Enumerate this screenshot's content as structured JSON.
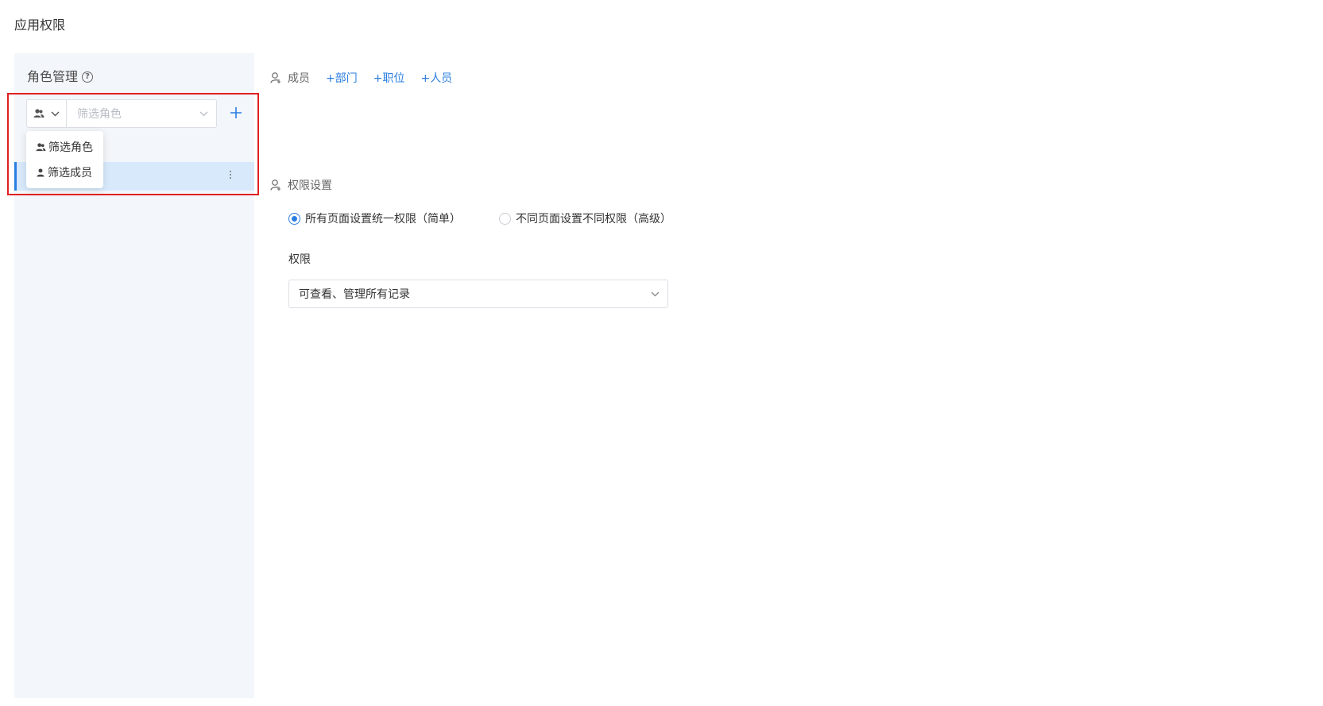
{
  "page": {
    "title": "应用权限"
  },
  "left_panel": {
    "heading": "角色管理",
    "filter": {
      "placeholder": "筛选角色"
    },
    "dropdown": {
      "items": [
        {
          "label": "筛选角色",
          "icon": "users-icon"
        },
        {
          "label": "筛选成员",
          "icon": "user-icon"
        }
      ]
    }
  },
  "members": {
    "label": "成员",
    "links": [
      "+部门",
      "+职位",
      "+人员"
    ]
  },
  "permission_settings": {
    "label": "权限设置",
    "options": [
      {
        "label": "所有页面设置统一权限（简单）",
        "checked": true
      },
      {
        "label": "不同页面设置不同权限（高级）",
        "checked": false
      }
    ],
    "field_label": "权限",
    "selected_value": "可查看、管理所有记录"
  },
  "colors": {
    "accent": "#2a7de1",
    "highlight": "#e02020",
    "panel_bg": "#f3f6fa",
    "selected_bg": "#d7e9fb"
  }
}
